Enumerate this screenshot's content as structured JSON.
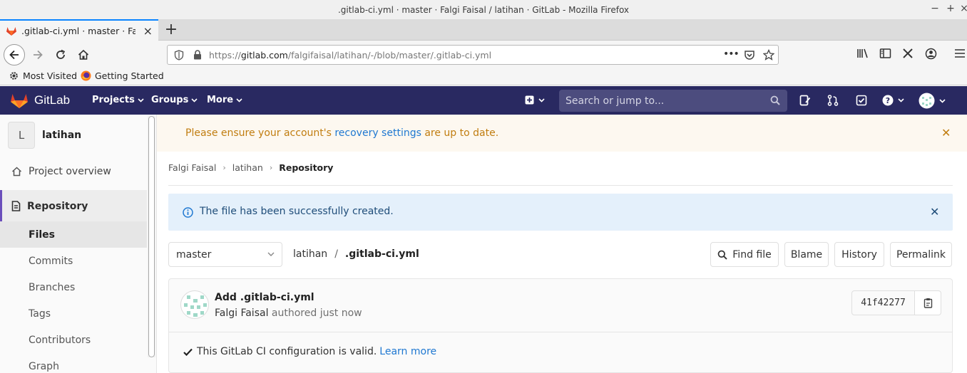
{
  "window": {
    "title": ".gitlab-ci.yml · master · Falgi Faisal / latihan · GitLab - Mozilla Firefox",
    "minimize": "−",
    "maximize": "+",
    "close": "×"
  },
  "tab": {
    "title": ".gitlab-ci.yml · master · Falgi F",
    "close": "×",
    "new_tab": "+"
  },
  "urlbar": {
    "url_prefix": "https://",
    "url_host": "gitlab.com",
    "url_path": "/falgifaisal/latihan/-/blob/master/.gitlab-ci.yml",
    "more": "•••"
  },
  "bookmarks": [
    {
      "label": "Most Visited",
      "icon": "gear-icon"
    },
    {
      "label": "Getting Started",
      "icon": "firefox-icon"
    }
  ],
  "gitlab_header": {
    "brand": "GitLab",
    "nav": [
      {
        "label": "Projects"
      },
      {
        "label": "Groups"
      },
      {
        "label": "More"
      }
    ],
    "search_placeholder": "Search or jump to...",
    "brand_color": "#292961"
  },
  "sidebar": {
    "project_initial": "L",
    "project_name": "latihan",
    "overview_label": "Project overview",
    "section_label": "Repository",
    "sub_items": [
      {
        "label": "Files",
        "active": true
      },
      {
        "label": "Commits"
      },
      {
        "label": "Branches"
      },
      {
        "label": "Tags"
      },
      {
        "label": "Contributors"
      },
      {
        "label": "Graph"
      }
    ]
  },
  "warning_alert": {
    "prefix": "Please ensure your account's ",
    "link": "recovery settings",
    "suffix": " are up to date.",
    "close": "✕"
  },
  "breadcrumb": {
    "items": [
      "Falgi Faisal",
      "latihan"
    ],
    "current": "Repository",
    "sep": "›"
  },
  "info_alert": {
    "message": "The file has been successfully created.",
    "close": "✕"
  },
  "file_view": {
    "branch": "master",
    "repo": "latihan",
    "slash": "/",
    "file_name": ".gitlab-ci.yml",
    "buttons": {
      "find_file": "Find file",
      "blame": "Blame",
      "history": "History",
      "permalink": "Permalink"
    }
  },
  "commit": {
    "title": "Add .gitlab-ci.yml",
    "author": "Falgi Faisal",
    "meta": " authored just now",
    "sha": "41f42277"
  },
  "ci_status": {
    "message": "This GitLab CI configuration is valid.",
    "link": "Learn more"
  }
}
